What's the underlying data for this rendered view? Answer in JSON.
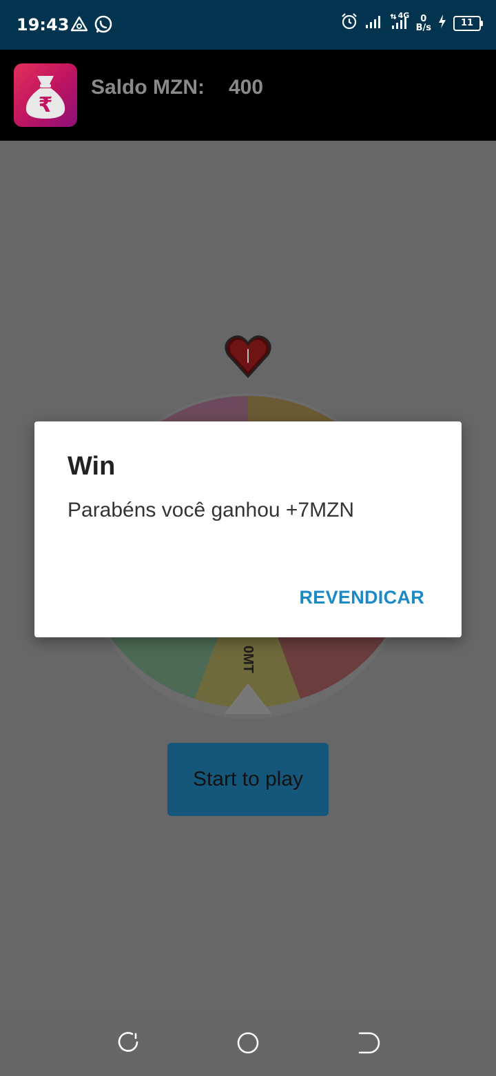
{
  "status_bar": {
    "time": "19:43",
    "network_label": "4G",
    "speed_value": "0",
    "speed_unit": "B/s",
    "battery_level": "11",
    "icons": [
      "triangle-alert-icon",
      "whatsapp-icon",
      "alarm-icon",
      "signal-icon",
      "signal-4g-icon",
      "charging-icon",
      "battery-icon"
    ]
  },
  "app_bar": {
    "app_icon": "money-bag-rupee-icon",
    "balance_label": "Saldo MZN:",
    "balance_value": "400"
  },
  "wheel": {
    "pointer_icon": "heart-pointer-icon",
    "visible_segment_label": "0MT",
    "segment_colors": [
      "#d470a0",
      "#d4a030",
      "#5dbf7a",
      "#d9c840",
      "#d85050"
    ]
  },
  "main": {
    "start_button_label": "Start to play"
  },
  "dialog": {
    "title": "Win",
    "message": "Parabéns você ganhou +7MZN",
    "action_label": "REVENDICAR"
  },
  "nav_bar": {
    "icons": [
      "recent-apps-icon",
      "home-icon",
      "back-icon"
    ]
  },
  "colors": {
    "status_bar": "#02344f",
    "app_bar": "#000000",
    "scrim_background": "#676767",
    "accent": "#1a8ac6",
    "start_button": "#15577a"
  }
}
